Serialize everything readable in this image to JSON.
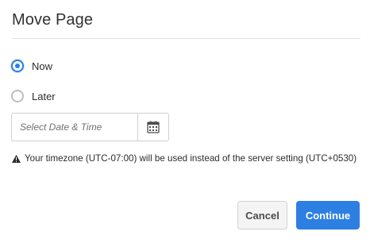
{
  "dialog": {
    "title": "Move Page",
    "options": [
      {
        "label": "Now",
        "checked": true
      },
      {
        "label": "Later",
        "checked": false
      }
    ],
    "date_field": {
      "placeholder": "Select Date & Time",
      "value": "",
      "icon": "calendar-icon"
    },
    "warning": {
      "icon": "warning-triangle-icon",
      "text": "Your timezone (UTC-07:00) will be used instead of the server setting (UTC+0530)"
    },
    "buttons": {
      "cancel_label": "Cancel",
      "continue_label": "Continue"
    }
  },
  "colors": {
    "accent": "#2d7fe2",
    "cancel_bg": "#f4f4f4"
  }
}
